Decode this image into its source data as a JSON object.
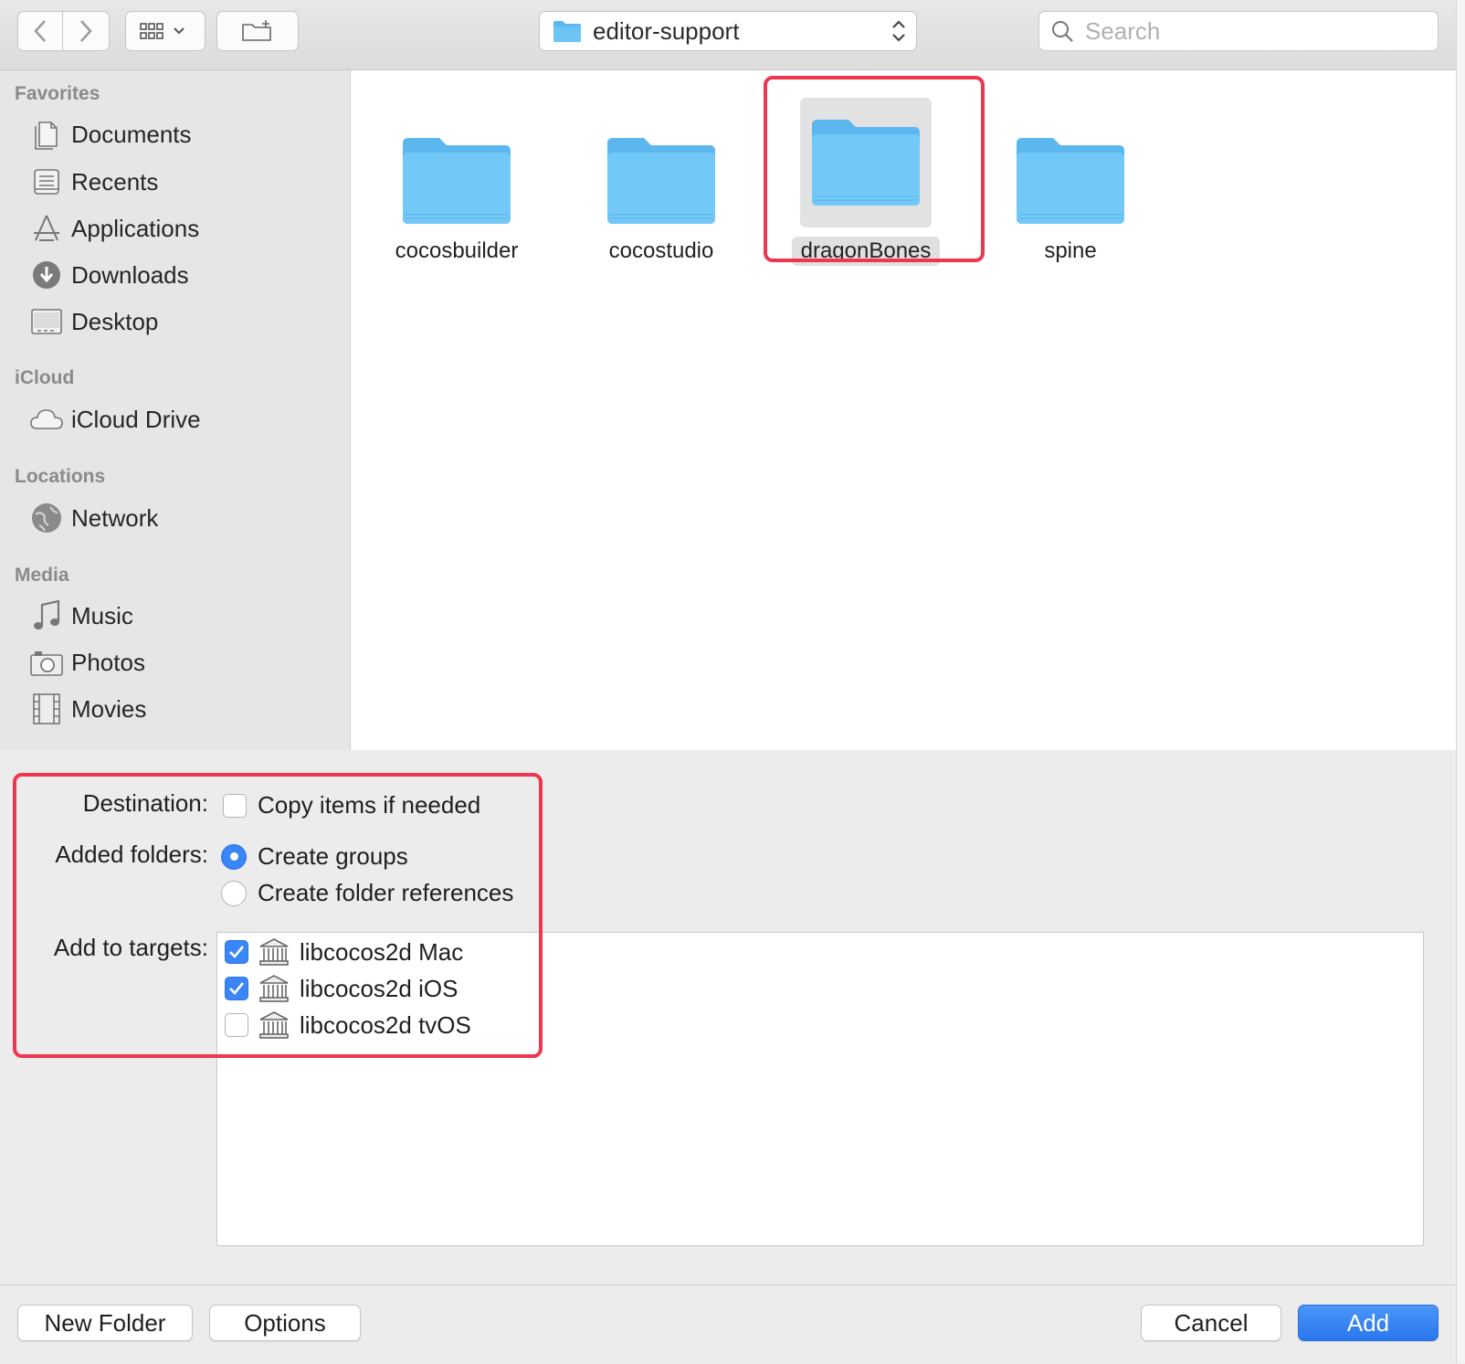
{
  "toolbar": {
    "back_icon": "chevron-left-icon",
    "forward_icon": "chevron-right-icon",
    "view_icon": "grid-view-icon",
    "new_folder_icon": "new-folder-icon",
    "path_label": "editor-support",
    "search_placeholder": "Search"
  },
  "sidebar": {
    "sections": [
      {
        "title": "Favorites",
        "items": [
          {
            "label": "Documents",
            "icon": "documents-icon"
          },
          {
            "label": "Recents",
            "icon": "recents-icon"
          },
          {
            "label": "Applications",
            "icon": "applications-icon"
          },
          {
            "label": "Downloads",
            "icon": "downloads-icon"
          },
          {
            "label": "Desktop",
            "icon": "desktop-icon"
          }
        ]
      },
      {
        "title": "iCloud",
        "items": [
          {
            "label": "iCloud Drive",
            "icon": "cloud-icon"
          }
        ]
      },
      {
        "title": "Locations",
        "items": [
          {
            "label": "Network",
            "icon": "network-globe-icon"
          }
        ]
      },
      {
        "title": "Media",
        "items": [
          {
            "label": "Music",
            "icon": "music-note-icon"
          },
          {
            "label": "Photos",
            "icon": "camera-icon"
          },
          {
            "label": "Movies",
            "icon": "film-icon"
          }
        ]
      }
    ]
  },
  "files": [
    {
      "name": "cocosbuilder",
      "selected": false
    },
    {
      "name": "cocostudio",
      "selected": false
    },
    {
      "name": "dragonBones",
      "selected": true
    },
    {
      "name": "spine",
      "selected": false
    }
  ],
  "options": {
    "destination_label": "Destination:",
    "copy_items_label": "Copy items if needed",
    "copy_items_checked": false,
    "added_folders_label": "Added folders:",
    "create_groups_label": "Create groups",
    "create_folder_refs_label": "Create folder references",
    "selected_folder_option": "Create groups",
    "add_to_targets_label": "Add to targets:",
    "targets": [
      {
        "label": "libcocos2d Mac",
        "checked": true,
        "icon": "library-target-icon"
      },
      {
        "label": "libcocos2d iOS",
        "checked": true,
        "icon": "library-target-icon"
      },
      {
        "label": "libcocos2d tvOS",
        "checked": false,
        "icon": "library-target-icon"
      }
    ]
  },
  "buttons": {
    "new_folder": "New Folder",
    "options": "Options",
    "cancel": "Cancel",
    "add": "Add"
  },
  "colors": {
    "accent": "#3b86f7",
    "folder": "#6cc4f5",
    "highlight": "#f0364e"
  }
}
